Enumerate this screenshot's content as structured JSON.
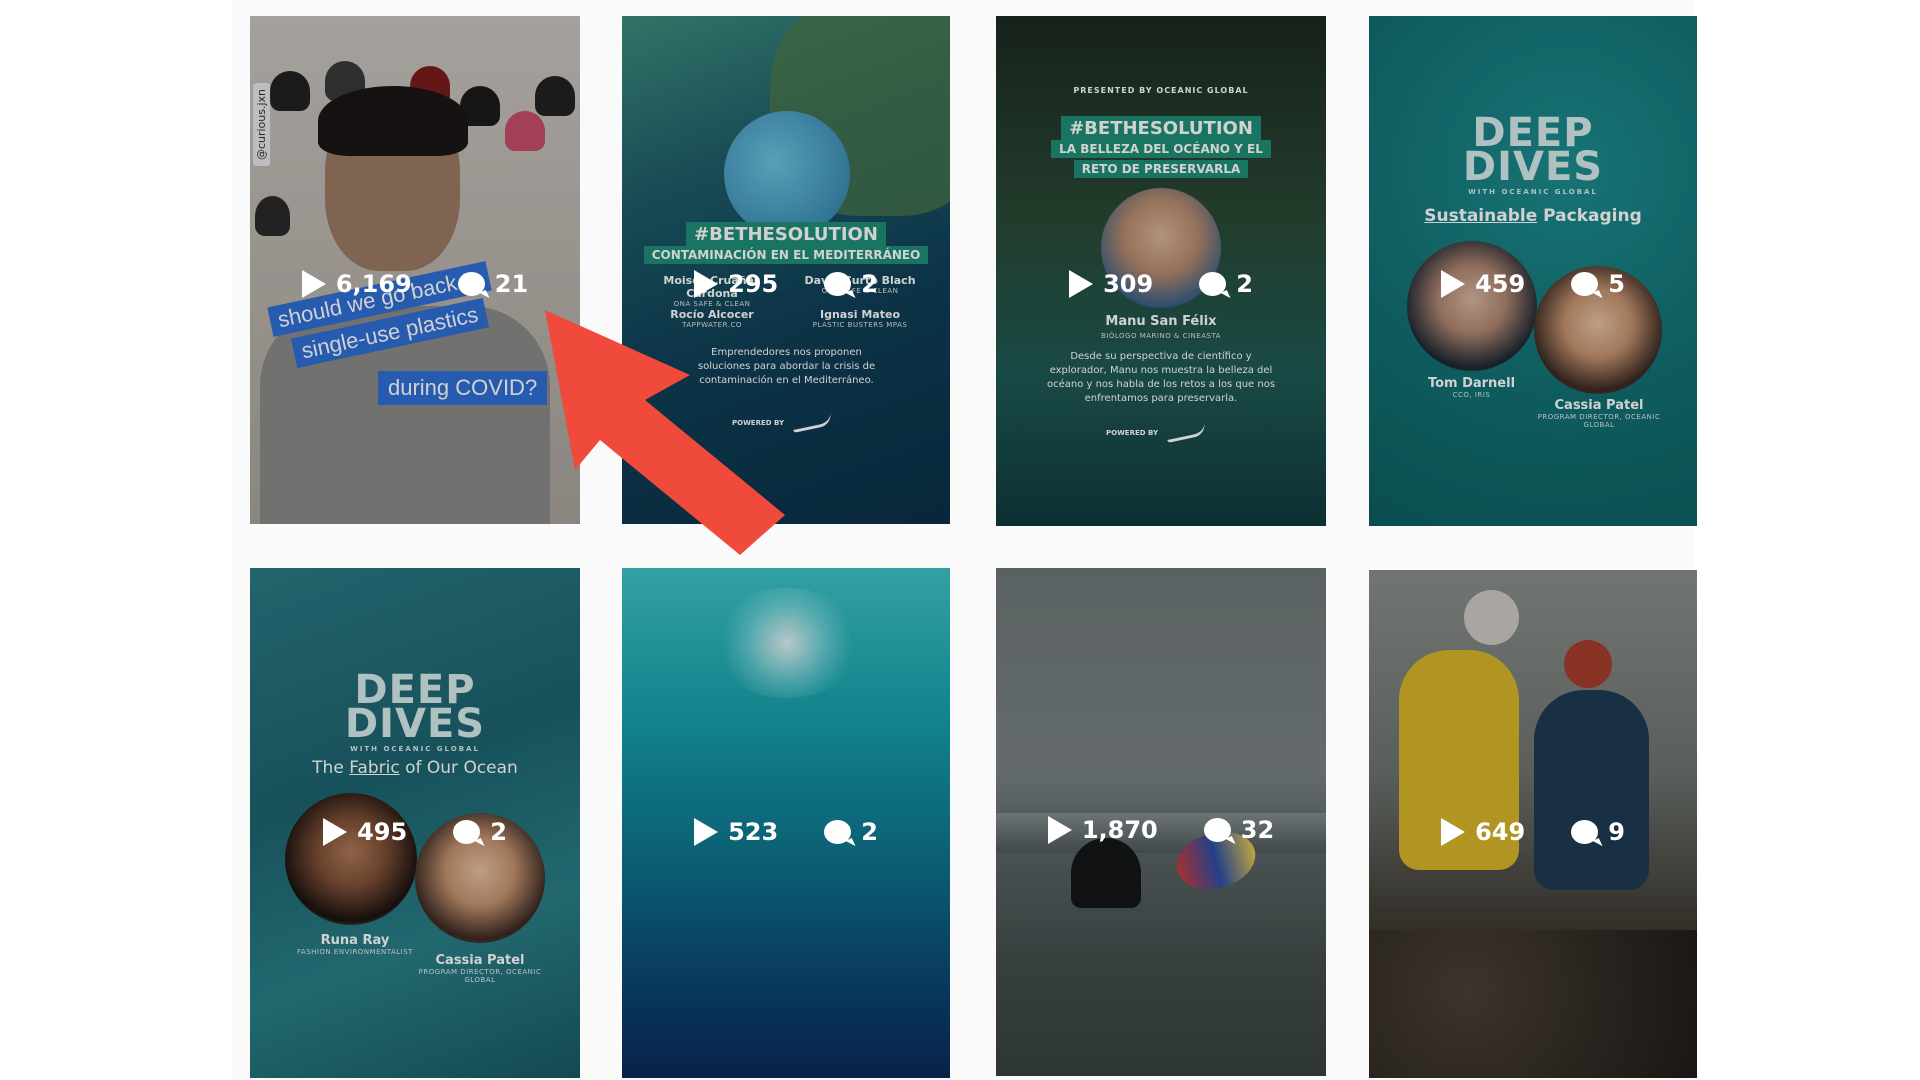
{
  "tiles": [
    {
      "plays": "6,169",
      "comments": "21",
      "handle": "@curious.jxn",
      "caption1": "should we go back to",
      "caption2": "single-use plastics",
      "caption3": "during COVID?"
    },
    {
      "plays": "295",
      "comments": "2",
      "hashtag": "#BETHESOLUTION",
      "subtitle": "CONTAMINACIÓN EN EL MEDITERRÁNEO",
      "person1": "Moisès Cruañas Cardona",
      "person1_org": "ONA SAFE & CLEAN",
      "person2": "David Curto Blach",
      "person2_org": "ONA SAFE & CLEAN",
      "person3": "Rocío Alcocer",
      "person3_org": "TAPPWATER.CO",
      "person4": "Ignasi Mateo",
      "person4_org": "PLASTIC BUSTERS MPAS",
      "body": "Emprendedores nos proponen soluciones para abordar la crisis de contaminación en el Mediterráneo.",
      "powered": "POWERED BY"
    },
    {
      "plays": "309",
      "comments": "2",
      "presented": "PRESENTED BY OCEANIC GLOBAL",
      "hashtag": "#BETHESOLUTION",
      "subtitle1": "LA BELLEZA DEL OCÉANO Y EL",
      "subtitle2": "RETO DE PRESERVARLA",
      "name": "Manu San Félix",
      "role": "BIÓLOGO MARINO & CINEASTA",
      "body": "Desde su perspectiva de científico y explorador, Manu nos muestra la belleza del océano y nos habla de los retos a los que nos enfrentamos para preservarla.",
      "powered": "POWERED BY"
    },
    {
      "plays": "459",
      "comments": "5",
      "logo1": "DEEP",
      "logo2": "DIVES",
      "logo_sub": "WITH OCEANIC GLOBAL",
      "topic_a": "Sustainable",
      "topic_b": "Packaging",
      "person1": "Tom Darnell",
      "person1_role": "CCO, IRIS",
      "person2": "Cassia Patel",
      "person2_role": "PROGRAM DIRECTOR, OCEANIC GLOBAL"
    },
    {
      "plays": "495",
      "comments": "2",
      "logo1": "DEEP",
      "logo2": "DIVES",
      "logo_sub": "WITH OCEANIC GLOBAL",
      "topic_a": "The",
      "topic_b": "Fabric",
      "topic_c": "of Our Ocean",
      "person1": "Runa Ray",
      "person1_role": "FASHION ENVIRONMENTALIST",
      "person2": "Cassia Patel",
      "person2_role": "PROGRAM DIRECTOR, OCEANIC GLOBAL"
    },
    {
      "plays": "523",
      "comments": "2"
    },
    {
      "plays": "1,870",
      "comments": "32"
    },
    {
      "plays": "649",
      "comments": "9"
    }
  ],
  "colors": {
    "arrow": "#f04a3c",
    "teal": "#0f6e72",
    "hashtag_bg": "#1f8f78",
    "caption_bg": "#2f6fd6"
  },
  "icons": [
    "play-icon",
    "comment-icon",
    "nike-swoosh-icon",
    "arrow-annotation"
  ]
}
